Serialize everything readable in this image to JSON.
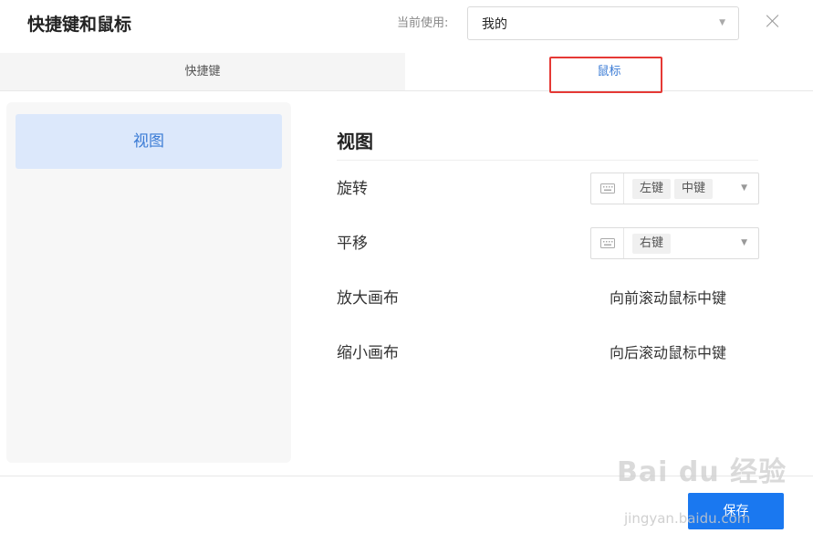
{
  "dialog": {
    "title": "快捷键和鼠标",
    "current_label": "当前使用:",
    "current_value": "我的"
  },
  "tabs": [
    {
      "label": "快捷键",
      "active": false
    },
    {
      "label": "鼠标",
      "active": true
    }
  ],
  "sidebar": {
    "items": [
      {
        "label": "视图",
        "selected": true
      }
    ]
  },
  "section": {
    "title": "视图",
    "rows": [
      {
        "label": "旋转",
        "tags": [
          "左键",
          "中键"
        ]
      },
      {
        "label": "平移",
        "tags": [
          "右键"
        ]
      },
      {
        "label": "放大画布",
        "value": "向前滚动鼠标中键"
      },
      {
        "label": "缩小画布",
        "value": "向后滚动鼠标中键"
      }
    ]
  },
  "footer": {
    "save_label": "保存"
  },
  "watermark": {
    "text": "Bai du 经验",
    "sub": "jingyan.baidu.com"
  },
  "colors": {
    "accent": "#1a78f0",
    "tab_active_text": "#3a7bd5",
    "highlight_border": "#e53935",
    "sidebar_selected_bg": "#dce8fb"
  }
}
